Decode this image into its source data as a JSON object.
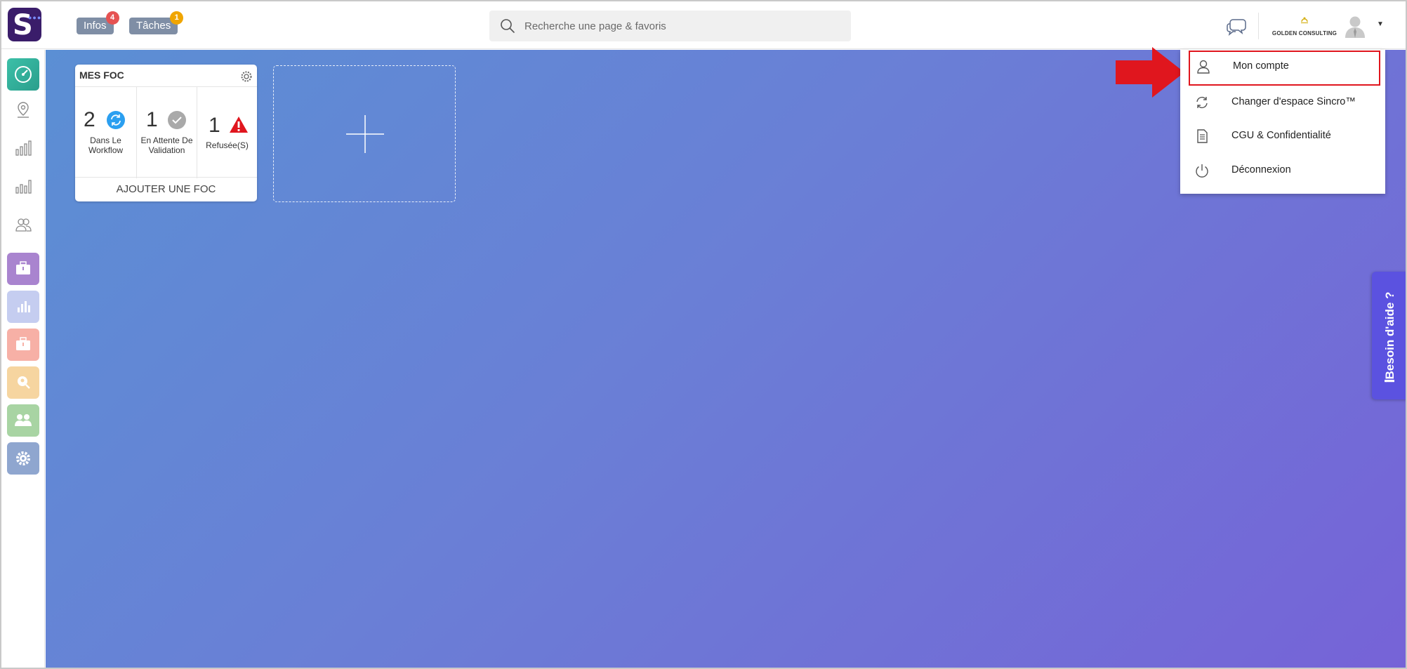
{
  "header": {
    "logo_letter": "S",
    "infos_label": "Infos",
    "infos_count": "4",
    "taches_label": "Tâches",
    "taches_count": "1",
    "search_placeholder": "Recherche une page & favoris",
    "company_name": "GOLDEN CONSULTING"
  },
  "widget": {
    "title": "MES FOC",
    "stats": [
      {
        "value": "2",
        "label_line1": "Dans Le",
        "label_line2": "Workflow"
      },
      {
        "value": "1",
        "label_line1": "En Attente De",
        "label_line2": "Validation"
      },
      {
        "value": "1",
        "label_line1": "Refusée(S)",
        "label_line2": ""
      }
    ],
    "footer_label": "AJOUTER UNE FOC"
  },
  "dropdown": {
    "items": [
      {
        "label": "Mon compte",
        "icon": "user-icon"
      },
      {
        "label": "Changer d'espace Sincro™",
        "icon": "refresh-icon"
      },
      {
        "label": "CGU & Confidentialité",
        "icon": "document-icon"
      },
      {
        "label": "Déconnexion",
        "icon": "power-icon"
      }
    ]
  },
  "help_tab": {
    "label": "Besoin d'aide ?"
  },
  "colors": {
    "accent_highlight": "#e0161e",
    "infos_badge": "#e65252",
    "taches_badge": "#f0a500",
    "help_tab": "#5b52e0"
  }
}
